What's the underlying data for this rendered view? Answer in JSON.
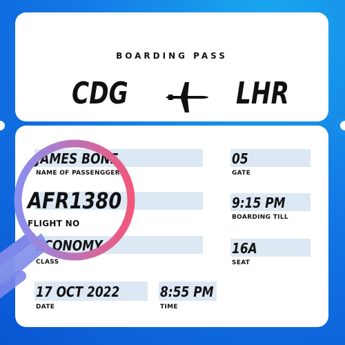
{
  "header": {
    "title": "BOARDING PASS",
    "origin": "CDG",
    "destination": "LHR",
    "plane_icon": "airplane-icon"
  },
  "fields": {
    "passenger": {
      "value": "JAMES BONE",
      "label": "NAME OF PASSENGGER"
    },
    "flight": {
      "value": "AFR1380",
      "label": "FLIGHT NO"
    },
    "class": {
      "value": "ECONOMY",
      "label": "CLASS"
    },
    "date": {
      "value": "17 OCT 2022",
      "label": "DATE"
    },
    "time": {
      "value": "8:55 PM",
      "label": "TIME"
    },
    "gate": {
      "value": "05",
      "label": "GATE"
    },
    "boarding": {
      "value": "9:15 PM",
      "label": "BOARDING TILL"
    },
    "seat": {
      "value": "16A",
      "label": "SEAT"
    }
  },
  "colors": {
    "background": "#1379e6",
    "card": "#ffffff",
    "field_bar": "#dce8f4",
    "magnifier_gradient_start": "#8a8ff0",
    "magnifier_gradient_end": "#f2577a"
  },
  "icons": [
    "airplane-icon",
    "magnifier-icon"
  ]
}
